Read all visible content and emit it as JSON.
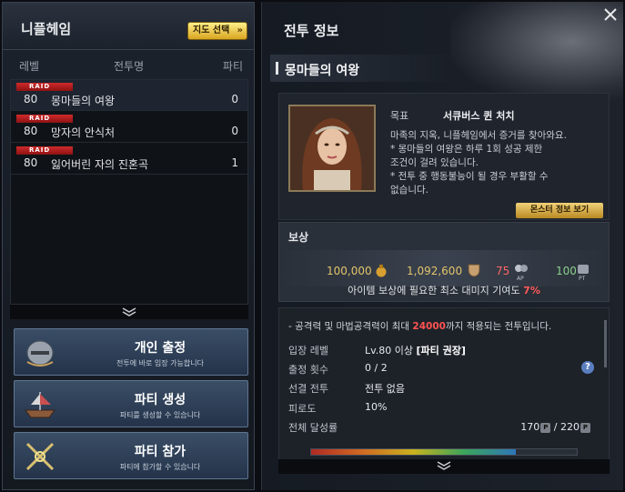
{
  "left": {
    "dungeon_name": "니플헤임",
    "map_button": "지도 선택",
    "columns": {
      "level": "레벨",
      "name": "전투명",
      "party": "파티"
    },
    "raid_tag": "RAID",
    "dungeons": [
      {
        "level": "80",
        "name": "몽마들의 여왕",
        "party": "0"
      },
      {
        "level": "80",
        "name": "망자의 안식처",
        "party": "0"
      },
      {
        "level": "80",
        "name": "잃어버린 자의 진혼곡",
        "party": "1"
      }
    ],
    "actions": {
      "solo": {
        "title": "개인 출정",
        "sub": "전투에 바로 입장 가능합니다"
      },
      "create": {
        "title": "파티 생성",
        "sub": "파티를 생성할 수 있습니다"
      },
      "join": {
        "title": "파티 참가",
        "sub": "파티에 참가할 수 있습니다"
      }
    }
  },
  "right": {
    "title": "전투 정보",
    "boss_name": "몽마들의 여왕",
    "goal_label": "목표",
    "goal_target": "서큐버스 퀸 처치",
    "description": [
      "마족의 지옥, 니플헤임에서 증거를 찾아와요.",
      "  * 몽마들의 여왕은 하루 1회 성공 제한",
      "  조건이 걸려 있습니다.",
      "  * 전투 중 행동불능이 될 경우 부활할 수",
      "  없습니다."
    ],
    "monster_button": "몬스터 정보 보기",
    "reward": {
      "title": "보상",
      "gold": "100,000",
      "silver": "1,092,600",
      "ap": "75",
      "pt": "100",
      "ap_label": "AP",
      "pt_label": "PT",
      "min_damage_text": "아이템 보상에 필요한 최소 대미지 기여도",
      "min_damage_pct": "7%"
    },
    "details": {
      "note_prefix": "- 공격력 및 마법공격력이 최대 ",
      "note_value": "24000",
      "note_suffix": "까지 적용되는 전투입니다.",
      "entry_level_label": "입장 레벨",
      "entry_level_value": "Lv.80 이상",
      "entry_level_extra": "[파티 권장]",
      "count_label": "출정 횟수",
      "count_value": "0 / 2",
      "prior_label": "선결 전투",
      "prior_value": "전투 없음",
      "fatigue_label": "피로도",
      "fatigue_value": "10%",
      "total_label": "전체 달성률",
      "total_current": "170",
      "total_sep": "/",
      "total_max": "220",
      "progress_fraction": 0.77
    },
    "colors": {
      "accent_gold": "#e3c46b",
      "highlight_red": "#ff5252"
    }
  }
}
